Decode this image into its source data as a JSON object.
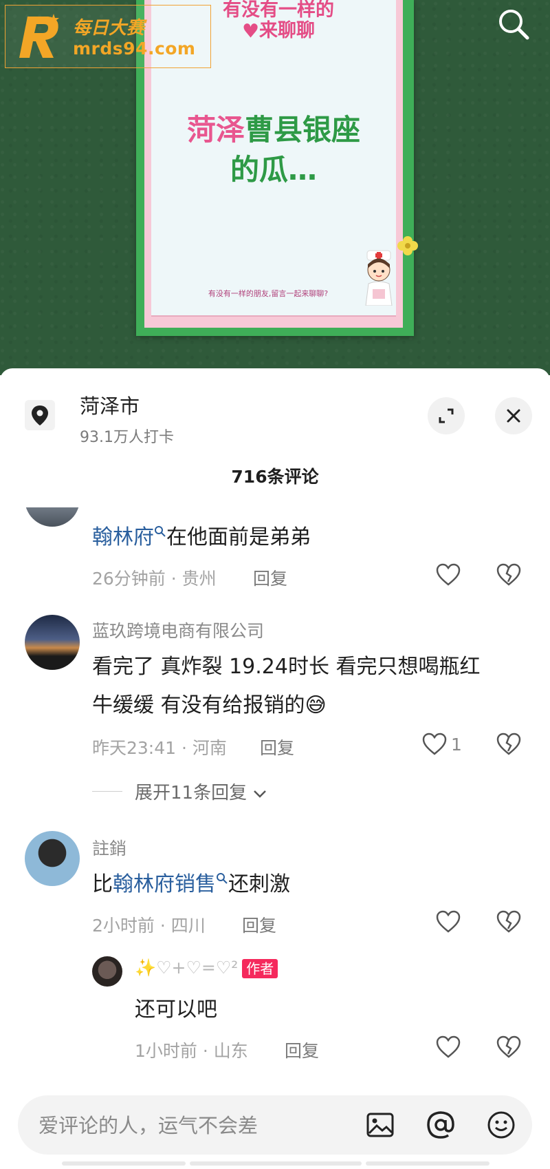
{
  "watermark": {
    "site_name_cn": "每日大赛",
    "site_url": "mrds94.com"
  },
  "poster": {
    "top_line1": "有没有一样的",
    "top_line2": "来聊聊",
    "headline_pink": "菏泽",
    "headline_green_1": "曹县银座",
    "headline_green_2": "的瓜…",
    "note": "有没有一样的朋友,留言一起来聊聊?"
  },
  "location": {
    "name": "菏泽市",
    "checkins": "93.1万人打卡"
  },
  "comments_count": "716条评论",
  "comments": [
    {
      "text_link": "翰林府",
      "text_rest": "在他面前是弟弟",
      "time_place": "26分钟前 · 贵州",
      "reply_label": "回复"
    },
    {
      "user": "蓝玖跨境电商有限公司",
      "line1": "看完了 真炸裂 19.24时长 看完只想喝瓶红",
      "line2": "牛缓缓 有没有给报销的😅",
      "time_place": "昨天23:41 · 河南",
      "reply_label": "回复",
      "likes": "1",
      "expand_label": "展开11条回复"
    },
    {
      "user": "註銷",
      "text_pre": "比",
      "text_link": "翰林府销售",
      "text_post": "还刺激",
      "time_place": "2小时前 · 四川",
      "reply_label": "回复"
    },
    {
      "user": "✨♡+♡=♡²",
      "author_badge": "作者",
      "text": "还可以吧",
      "time_place": "1小时前 · 山东",
      "reply_label": "回复"
    }
  ],
  "input": {
    "placeholder": "爱评论的人，运气不会差"
  },
  "colors": {
    "link": "#2a5f9e",
    "author_badge": "#f5295c",
    "watermark": "#f3a626",
    "poster_green": "#2e9a46",
    "poster_pink": "#e8568f"
  },
  "icons": [
    "search-icon",
    "location-pin-icon",
    "expand-icon",
    "close-icon",
    "heart-icon",
    "broken-heart-icon",
    "chevron-down-icon",
    "image-icon",
    "at-icon",
    "emoji-icon",
    "search-magnifier-icon"
  ]
}
